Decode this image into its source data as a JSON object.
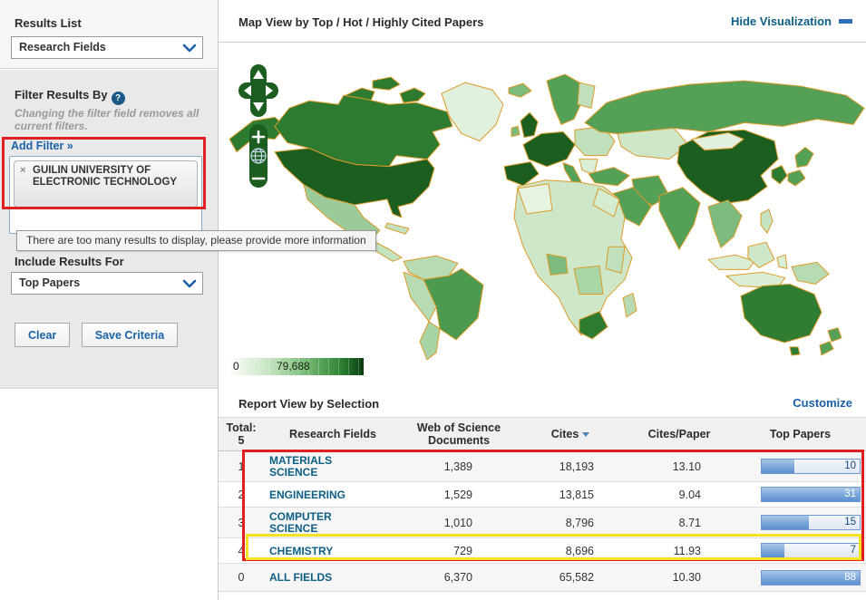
{
  "sidebar": {
    "results_list": {
      "title": "Results List",
      "selected": "Research Fields"
    },
    "filter": {
      "title": "Filter Results By",
      "help_icon": "?",
      "note": "Changing the filter field removes all current filters.",
      "add_filter_label": "Add Filter »",
      "chip": {
        "remove_icon": "×",
        "text": "GUILIN UNIVERSITY OF ELECTRONIC TECHNOLOGY"
      },
      "tooltip": "There are too many results to display, please provide more information"
    },
    "include_results": {
      "title": "Include Results For",
      "selected": "Top Papers"
    },
    "buttons": {
      "clear": "Clear",
      "save": "Save Criteria"
    }
  },
  "map_panel": {
    "title": "Map View by Top / Hot / Highly Cited Papers",
    "hide_link": "Hide Visualization",
    "legend": {
      "min": "0",
      "max": "79,688"
    }
  },
  "report": {
    "title": "Report View by Selection",
    "customize_link": "Customize",
    "table": {
      "total_label": "Total:",
      "total_count": "5",
      "headers": {
        "field": "Research Fields",
        "docs": "Web of Science Documents",
        "cites": "Cites",
        "cpp": "Cites/Paper",
        "top": "Top Papers"
      },
      "rows": [
        {
          "rank": "1",
          "field": "MATERIALS SCIENCE",
          "docs": "1,389",
          "cites": "18,193",
          "cpp": "13.10",
          "top_papers": "10",
          "bar_pct": 33
        },
        {
          "rank": "2",
          "field": "ENGINEERING",
          "docs": "1,529",
          "cites": "13,815",
          "cpp": "9.04",
          "top_papers": "31",
          "bar_pct": 100
        },
        {
          "rank": "3",
          "field": "COMPUTER SCIENCE",
          "docs": "1,010",
          "cites": "8,796",
          "cpp": "8.71",
          "top_papers": "15",
          "bar_pct": 48
        },
        {
          "rank": "4",
          "field": "CHEMISTRY",
          "docs": "729",
          "cites": "8,696",
          "cpp": "11.93",
          "top_papers": "7",
          "bar_pct": 23
        },
        {
          "rank": "0",
          "field": "ALL FIELDS",
          "docs": "6,370",
          "cites": "65,582",
          "cpp": "10.30",
          "top_papers": "88",
          "bar_pct": 100
        }
      ]
    }
  },
  "colors": {
    "accent_blue": "#1b62a8",
    "link_teal": "#0d5f85",
    "map_dark_green": "#1b5e20",
    "map_border_orange": "#dd9b2a",
    "annotation_red": "#e02020",
    "annotation_yellow": "#f2e222",
    "bar_blue": "#5d8fcf"
  }
}
